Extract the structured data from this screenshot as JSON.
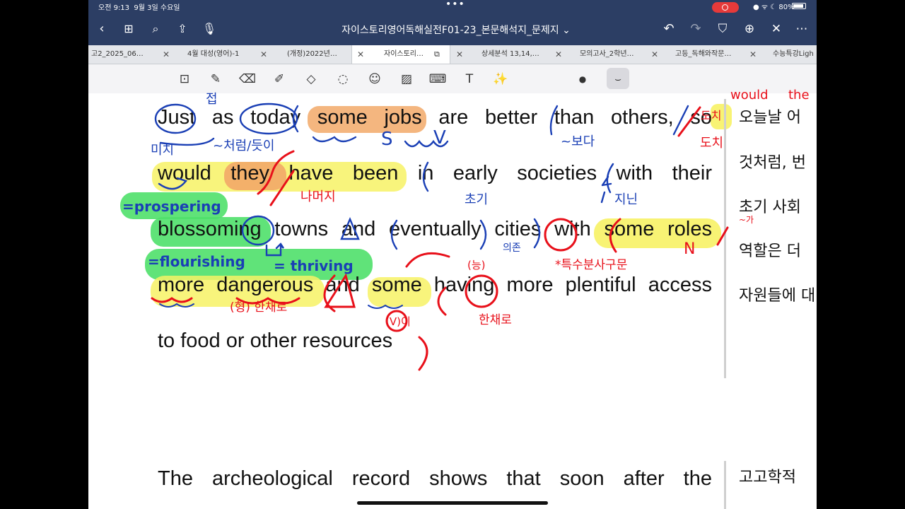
{
  "status": {
    "time": "오전 9:13",
    "date": "9월 3일 수요일",
    "battery": "80%"
  },
  "title_bar": {
    "title": "자이스토리영어독해실전F01-23_본문해석지_문제지 ⌄"
  },
  "icons": {
    "back": "chevron-left-icon",
    "grid": "grid-icon",
    "search": "search-icon",
    "share": "share-icon",
    "mic": "mic-icon",
    "undo": "undo-icon",
    "redo": "redo-icon",
    "bookmark": "bookmark-icon",
    "add_page": "add-page-icon",
    "close_edit": "pen-off-icon",
    "more": "more-icon"
  },
  "tabs": [
    {
      "label": "고2_2025_06…"
    },
    {
      "label": "4월 대성(영어)-1"
    },
    {
      "label": "(개정)2022년…"
    },
    {
      "label": "자이스토리…"
    },
    {
      "label": "상세분석 13,14,…"
    },
    {
      "label": "모의고사_2학년…"
    },
    {
      "label": "고등_독해와작문…"
    },
    {
      "label": "수능특강Ligh"
    }
  ],
  "colors": {
    "title_bar": "#2c3e64",
    "yellow_highlight": "#f7f265",
    "orange_highlight": "#f2a968",
    "green_highlight": "#4fe06a",
    "blue_ink": "#1a3fb5",
    "red_ink": "#e8101a"
  },
  "document": {
    "lines": [
      "Just as today some jobs are better than others, so",
      "would they have been in early societies with their",
      "blossoming towns and eventually cities with some roles",
      "more dangerous and some having more plentiful access",
      "to food or other resources",
      "The archeological record shows that soon after the"
    ],
    "korean": [
      "오늘날 어",
      "것처럼, 번",
      "초기 사회",
      "역할은 더",
      "자원들에 대",
      "고고학적"
    ]
  },
  "annotations": {
    "blue": [
      "접",
      "미치",
      "~처럼/듯이",
      "S",
      "V",
      "~보다",
      "초기",
      "지닌",
      "의존",
      "=prospering",
      "=flourishing",
      "= thriving"
    ],
    "red": [
      "도치",
      "도치",
      "would",
      "the",
      "나머지",
      "~가",
      "N",
      "*특수분사구문",
      "(능)",
      "(형) 한채로",
      "한채로",
      "(V)이"
    ]
  }
}
